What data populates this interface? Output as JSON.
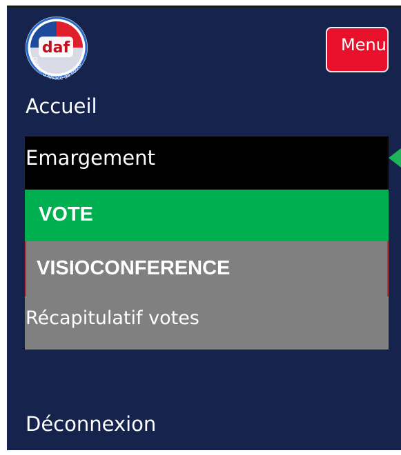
{
  "header": {
    "logo_name": "daf-logo",
    "logo_text": "daf",
    "logo_caption": "District d'Alsace de Football",
    "menu_label": "Menu"
  },
  "nav": {
    "accueil": "Accueil",
    "emargement": "Emargement",
    "vote": "VOTE",
    "visioconference": "VISIOCONFERENCE",
    "recapitulatif": "Récapitulatif votes",
    "deconnexion": "Déconnexion"
  },
  "colors": {
    "panel_background": "#16244d",
    "menu_button": "#e8102a",
    "emargement_highlight": "#000000",
    "vote_highlight": "#00b050",
    "submenu_background": "#808080",
    "indicator": "#1fb35a"
  },
  "icons": {
    "active_indicator": "arrow-left-icon"
  }
}
